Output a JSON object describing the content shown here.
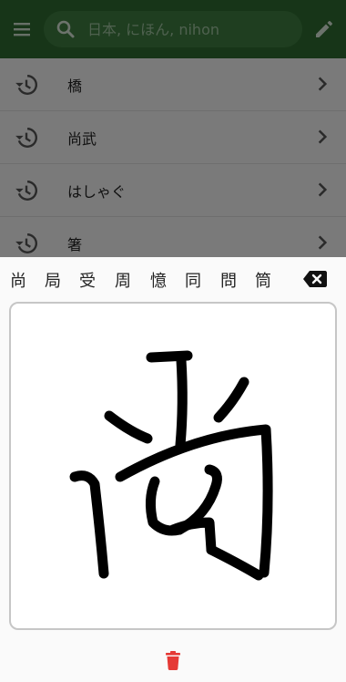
{
  "search": {
    "placeholder": "日本, にほん, nihon"
  },
  "history": [
    {
      "label": "橋"
    },
    {
      "label": "尚武"
    },
    {
      "label": "はしゃぐ"
    },
    {
      "label": "箸"
    }
  ],
  "candidates": [
    "尚",
    "局",
    "受",
    "周",
    "憶",
    "同",
    "問",
    "筒"
  ],
  "icons": {
    "menu": "menu-icon",
    "search": "search-icon",
    "edit": "pencil-icon",
    "history": "history-icon",
    "chevron": "chevron-right-icon",
    "backspace": "backspace-icon",
    "trash": "trash-icon"
  },
  "colors": {
    "app_bar": "#2e6b30",
    "search_box": "#3f7d41",
    "trash": "#e53935",
    "ink": "#000000"
  }
}
